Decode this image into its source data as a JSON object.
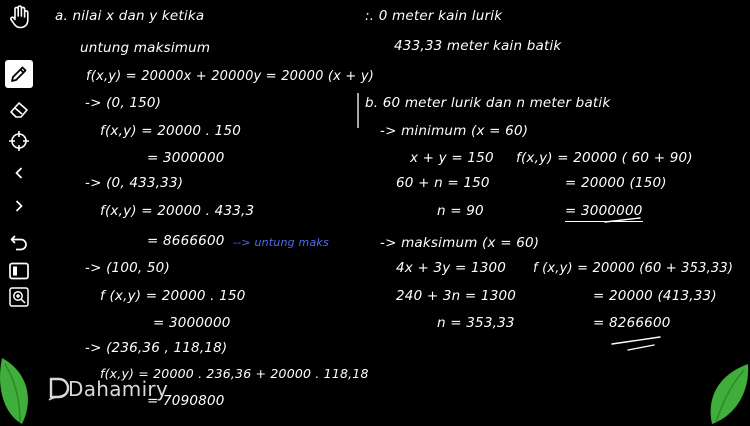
{
  "toolbar": {
    "tools": [
      {
        "name": "hand-tool-button",
        "icon": "hand-icon"
      },
      {
        "name": "pen-tool-button",
        "icon": "pencil-icon"
      },
      {
        "name": "eraser-tool-button",
        "icon": "eraser-icon"
      },
      {
        "name": "laser-pointer-button",
        "icon": "crosshair-icon"
      },
      {
        "name": "previous-page-button",
        "icon": "chevron-left-icon"
      },
      {
        "name": "next-page-button",
        "icon": "chevron-right-icon"
      },
      {
        "name": "undo-button",
        "icon": "undo-icon"
      },
      {
        "name": "slide-view-button",
        "icon": "rectangle-icon"
      },
      {
        "name": "zoom-button",
        "icon": "zoom-in-icon"
      }
    ],
    "accent": "#ffffff"
  },
  "left": {
    "l1": "a. nilai  x  dan  y   ketika",
    "l2": "untung  maksimum",
    "l3": "f(x,y) = 20000x + 20000y = 20000 (x + y)",
    "l4": "-> (0, 150)",
    "l5": "f(x,y) = 20000 . 150",
    "l6": "= 3000000",
    "l7": "-> (0, 433,33)",
    "l8": "f(x,y) = 20000 . 433,3",
    "l9": "= 8666600",
    "l9_note": "--> untung  maks",
    "l10": "-> (100, 50)",
    "l11": "f (x,y) = 20000 . 150",
    "l12": "= 3000000",
    "l13": "-> (236,36  ,  118,18)",
    "l14": "f(x,y) = 20000 . 236,36 + 20000 . 118,18",
    "l15": "= 7090800"
  },
  "right": {
    "r1": ":.  0  meter  kain  lurik",
    "r2": "433,33  meter  kain  batik",
    "r3": "b.  60  meter  lurik  dan      n    meter  batik",
    "r4": "-> minimum (x = 60)",
    "r5": "x + y  =  150",
    "r6": "60 + n  =  150",
    "r7": "n  =  90",
    "r8": "f(x,y) = 20000 ( 60 + 90)",
    "r9": "= 20000 (150)",
    "r10": "= 3000000",
    "r11": "-> maksimum (x = 60)",
    "r12": "4x + 3y = 1300",
    "r13": "240 + 3n = 1300",
    "r14": "n = 353,33",
    "r15": "f (x,y) = 20000 (60 + 353,33)",
    "r16": "= 20000 (413,33)",
    "r17": "= 8266600"
  },
  "watermark": {
    "text": "Dahamiry",
    "color": "#d9d9d9"
  },
  "colors": {
    "ink": "#ffffff",
    "note": "#4d6ff0",
    "leaf": "#3fae3a"
  }
}
